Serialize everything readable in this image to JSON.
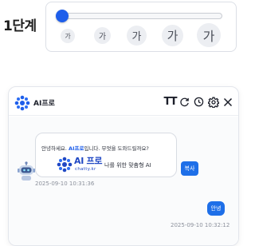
{
  "step": {
    "label": "1단계"
  },
  "font_size": {
    "level": 0,
    "options": [
      "가",
      "가",
      "가",
      "가",
      "가"
    ]
  },
  "chat": {
    "brand": "AI프로",
    "header_icons": [
      "text-size-icon",
      "refresh-icon",
      "history-icon",
      "settings-icon",
      "close-icon"
    ],
    "text_size_label": "TT",
    "greeting_before": "안녕하세요. ",
    "greeting_brand": "AI프로",
    "greeting_after": "입니다. 무엇을 도와드릴까요?",
    "promo_title": "AI 프로",
    "promo_domain": "chatty.kr",
    "promo_slogan": "나를 위한 맞춤형 AI",
    "copy_label": "복사",
    "bot_timestamp": "2025-09-10 10:31:36",
    "user_message": "안녕",
    "user_timestamp": "2025-09-10 10:32:12"
  },
  "colors": {
    "accent": "#1e5eea",
    "button": "#1e6fe8",
    "logo": "#2048c4"
  }
}
